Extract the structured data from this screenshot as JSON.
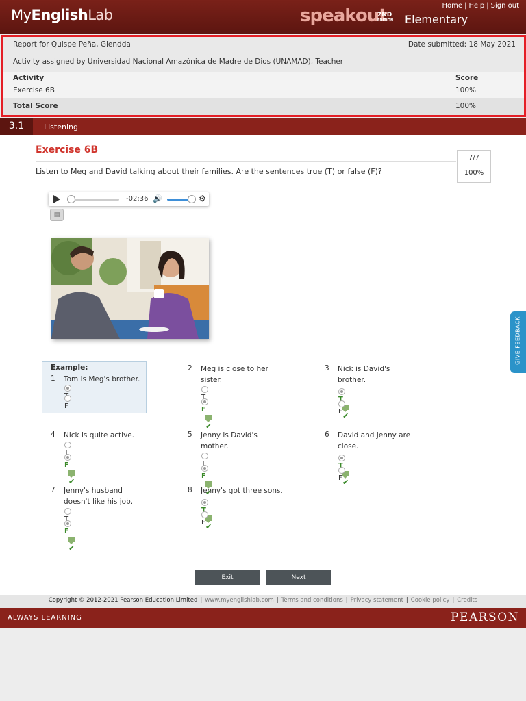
{
  "header": {
    "logo": {
      "my": "My",
      "english": "English",
      "lab": "Lab"
    },
    "links": [
      "Home",
      "Help",
      "Sign out"
    ],
    "brand_name": "speakout",
    "brand_edition_1": "2ND",
    "brand_edition_2": "EDITION",
    "level": "Elementary"
  },
  "report": {
    "report_for": "Report for Quispe Peña, Glendda",
    "date_submitted": "Date submitted: 18 May 2021",
    "assigned_by": "Activity assigned by Universidad Nacional Amazónica de Madre de Dios (UNAMAD), Teacher",
    "col_activity": "Activity",
    "col_score": "Score",
    "row_activity": "Exercise 6B",
    "row_score": "100%",
    "total_label": "Total Score",
    "total_score": "100%"
  },
  "section": {
    "number": "3.1",
    "name": "Listening"
  },
  "exercise": {
    "title": "Exercise 6B",
    "instruction": "Listen to Meg and David talking about their families. Are the sentences true (T) or false (F)?",
    "score_fraction": "7/7",
    "score_percent": "100%"
  },
  "player": {
    "time": "-02:36",
    "progress_fraction": 0.0,
    "volume_fraction": 0.85,
    "icons": [
      "play-icon",
      "volume-icon",
      "gear-icon",
      "transcript-icon"
    ]
  },
  "questions": {
    "example_label": "Example:",
    "items": [
      {
        "num": "1",
        "text": "Tom is Meg's brother.",
        "opt_t": "T",
        "opt_f": "F"
      },
      {
        "num": "2",
        "text": "Meg is close to her sister.",
        "opt_t": "T",
        "opt_f": "F"
      },
      {
        "num": "3",
        "text": "Nick is David's brother.",
        "opt_t": "T",
        "opt_f": "F"
      },
      {
        "num": "4",
        "text": "Nick is quite active.",
        "opt_t": "T",
        "opt_f": "F"
      },
      {
        "num": "5",
        "text": "Jenny is David's mother.",
        "opt_t": "T",
        "opt_f": "F"
      },
      {
        "num": "6",
        "text": "David and Jenny are close.",
        "opt_t": "T",
        "opt_f": "F"
      },
      {
        "num": "7",
        "text": "Jenny's husband doesn't like his job.",
        "opt_t": "T",
        "opt_f": "F"
      },
      {
        "num": "8",
        "text": "Jenny's got three sons.",
        "opt_t": "T",
        "opt_f": "F"
      }
    ]
  },
  "buttons": {
    "exit": "Exit",
    "next": "Next"
  },
  "footer": {
    "copyright": "Copyright © 2012-2021 Pearson Education Limited",
    "site": "www.myenglishlab.com",
    "terms": "Terms and conditions",
    "privacy": "Privacy statement",
    "cookie": "Cookie policy",
    "credits": "Credits",
    "always_learning": "ALWAYS LEARNING",
    "pearson": "PEARSON"
  },
  "feedback_tab": "GIVE FEEDBACK",
  "colors": {
    "header": "#6f1c15",
    "accent_red": "#d0342c",
    "report_border": "#e41e26",
    "correct_green": "#3b8a2a",
    "feedback_blue": "#2b93c9"
  }
}
